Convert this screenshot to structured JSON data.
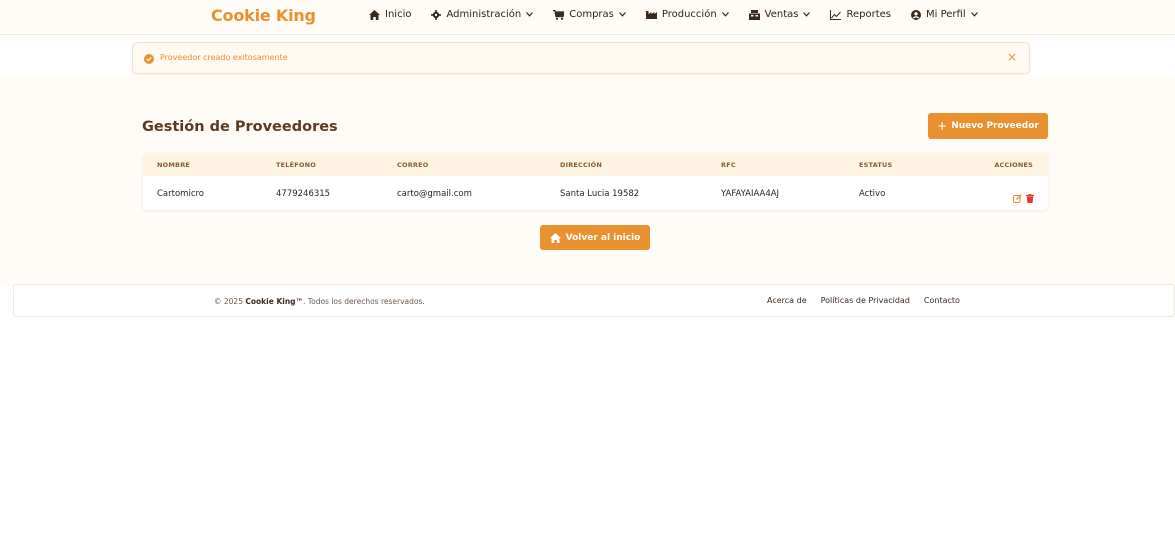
{
  "brand": "Cookie King",
  "nav": [
    {
      "icon": "home-icon",
      "label": "Inicio",
      "dropdown": false
    },
    {
      "icon": "gear-icon",
      "label": "Administración",
      "dropdown": true
    },
    {
      "icon": "cart-icon",
      "label": "Compras",
      "dropdown": true
    },
    {
      "icon": "factory-icon",
      "label": "Producción",
      "dropdown": true
    },
    {
      "icon": "store-icon",
      "label": "Ventas",
      "dropdown": true
    },
    {
      "icon": "chart-icon",
      "label": "Reportes",
      "dropdown": false
    },
    {
      "icon": "user-circle-icon",
      "label": "Mi Perfil",
      "dropdown": true
    }
  ],
  "alert": {
    "message": "Proveedor creado exitosamente",
    "close": "×"
  },
  "page": {
    "title": "Gestión de Proveedores",
    "new_button": "Nuevo Proveedor",
    "home_button": "Volver al inicio"
  },
  "table": {
    "headers": [
      "NOMBRE",
      "TELÉFONO",
      "CORREO",
      "DIRECCIÓN",
      "RFC",
      "ESTATUS",
      "ACCIONES"
    ],
    "rows": [
      {
        "nombre": "Cartomicro",
        "telefono": "4779246315",
        "correo": "carto@gmail.com",
        "direccion": "Santa Lucia 19582",
        "rfc": "YAFAYAIAA4AJ",
        "estatus": "Activo"
      }
    ]
  },
  "footer": {
    "year_prefix": "© 2025",
    "brand": "Cookie King™",
    "suffix": ". Todos los derechos reservados.",
    "links": [
      "Acerca de",
      "Políticas de Privacidad",
      "Contacto"
    ]
  },
  "colors": {
    "accent": "#e8912e",
    "title": "#5a3a22",
    "delete": "#e53935"
  }
}
